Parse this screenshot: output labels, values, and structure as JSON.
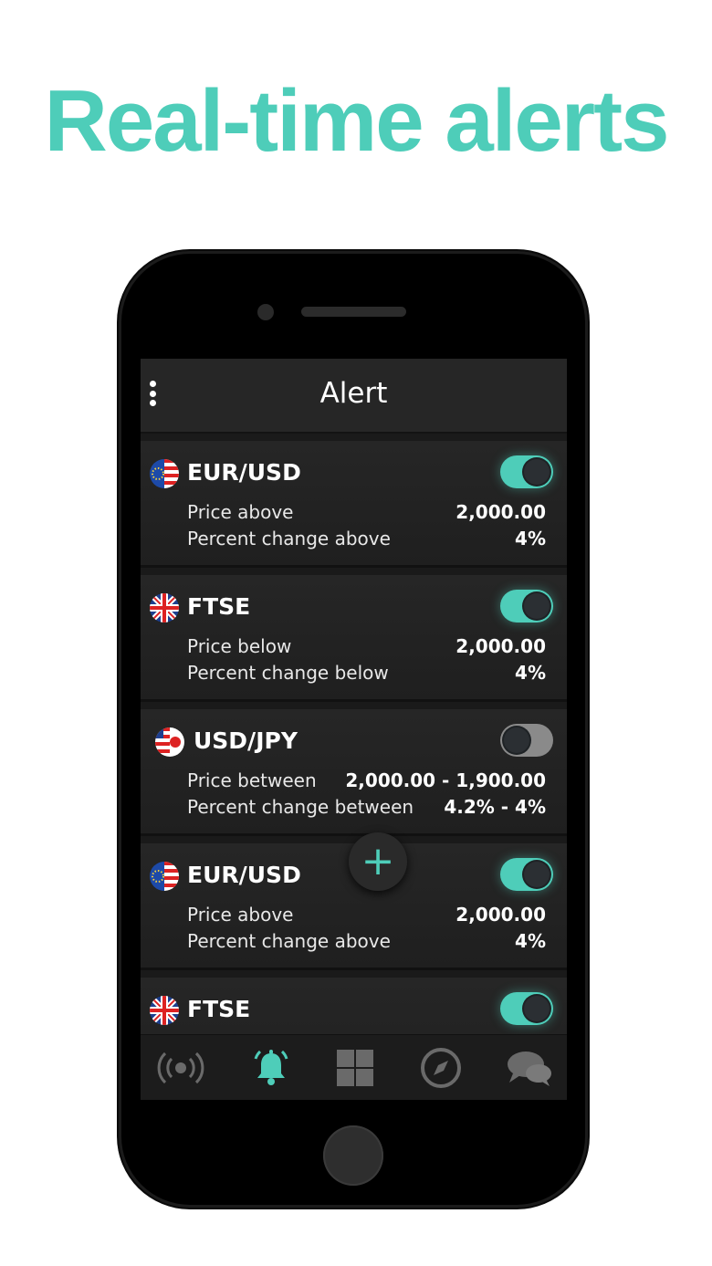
{
  "headline": "Real-time alerts",
  "app": {
    "title": "Alert"
  },
  "colors": {
    "accent": "#4ecdb9",
    "background": "#1a1a1a",
    "card": "#232323",
    "text": "#ffffff"
  },
  "alerts": [
    {
      "symbol": "EUR/USD",
      "flag": "eu-us-flag-icon",
      "enabled": true,
      "rows": [
        {
          "label": "Price above",
          "value": "2,000.00"
        },
        {
          "label": "Percent change above",
          "value": "4%"
        }
      ]
    },
    {
      "symbol": "FTSE",
      "flag": "uk-flag-icon",
      "enabled": true,
      "rows": [
        {
          "label": "Price below",
          "value": "2,000.00"
        },
        {
          "label": "Percent change below",
          "value": "4%"
        }
      ]
    },
    {
      "symbol": "USD/JPY",
      "flag": "us-jp-flag-icon",
      "enabled": false,
      "rows": [
        {
          "label": "Price between",
          "value": "2,000.00 - 1,900.00"
        },
        {
          "label": "Percent change between",
          "value": "4.2% - 4%"
        }
      ]
    },
    {
      "symbol": "EUR/USD",
      "flag": "eu-us-flag-icon",
      "enabled": true,
      "rows": [
        {
          "label": "Price above",
          "value": "2,000.00"
        },
        {
          "label": "Percent change above",
          "value": "4%"
        }
      ]
    },
    {
      "symbol": "FTSE",
      "flag": "uk-flag-icon",
      "enabled": true,
      "rows": []
    }
  ],
  "fab": {
    "label": "+"
  },
  "nav": [
    {
      "name": "live-icon",
      "active": false
    },
    {
      "name": "bell-icon",
      "active": true
    },
    {
      "name": "grid-icon",
      "active": false
    },
    {
      "name": "compass-icon",
      "active": false
    },
    {
      "name": "chat-icon",
      "active": false
    }
  ]
}
